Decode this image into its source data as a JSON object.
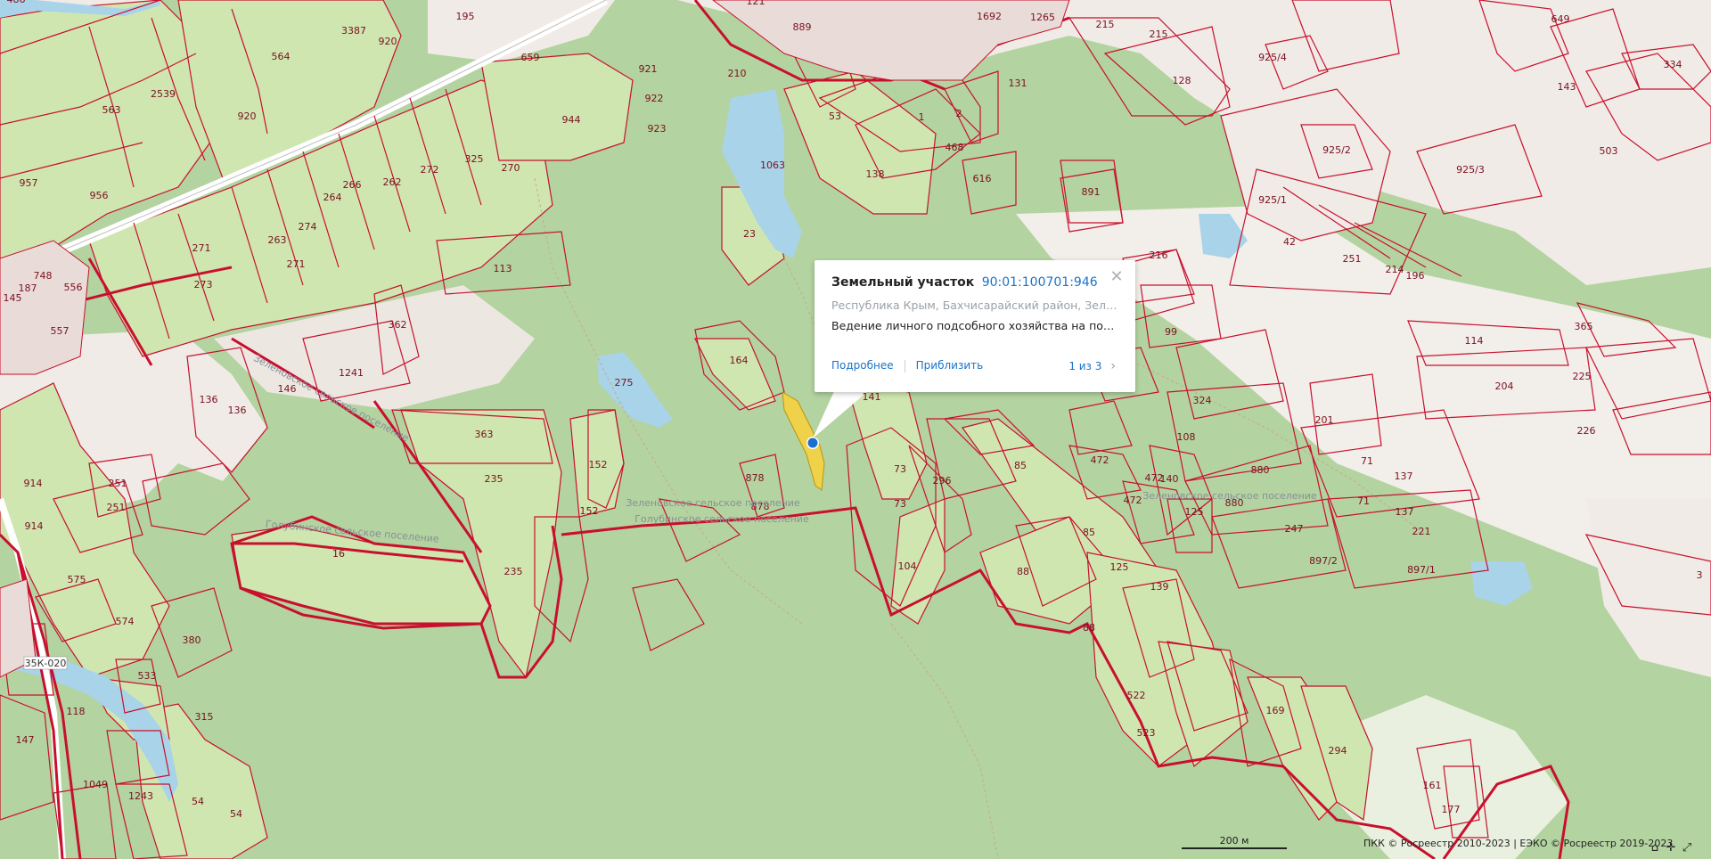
{
  "popup": {
    "title": "Земельный участок",
    "cadastral_number": "90:01:100701:946",
    "address": "Республика Крым, Бахчисарайский район, Зеленовс...",
    "land_use": "Ведение личного подсобного хозяйства на полевых...",
    "more_label": "Подробнее",
    "zoom_label": "Приблизить",
    "pager": "1 из 3",
    "close_icon": "close-icon",
    "next_icon": "chevron-right-icon"
  },
  "map": {
    "colors": {
      "background": "#b3d3a0",
      "forest": "#a8cb92",
      "light_green": "#cfe6b0",
      "land": "#f0ebe6",
      "water": "#a8d3e8",
      "border": "#c8102e",
      "selected": "#f0d24a",
      "marker": "#1a6fd1"
    },
    "labels": {
      "plots": [
        "486",
        "195",
        "3387",
        "920",
        "564",
        "2539",
        "920",
        "563",
        "957",
        "956",
        "659",
        "921",
        "922",
        "923",
        "944",
        "210",
        "53",
        "138",
        "1063",
        "23",
        "121",
        "889",
        "1265",
        "1692",
        "215",
        "215",
        "128",
        "649",
        "143",
        "503",
        "334",
        "925/4",
        "925/2",
        "925/3",
        "925/1",
        "891",
        "216",
        "42",
        "251",
        "214",
        "196",
        "114",
        "365",
        "204",
        "225",
        "226",
        "113",
        "271",
        "271",
        "273",
        "263",
        "274",
        "264",
        "266",
        "262",
        "272",
        "325",
        "270",
        "362",
        "1241",
        "146",
        "136",
        "136",
        "557",
        "556",
        "748",
        "187",
        "145",
        "914",
        "914",
        "251",
        "251",
        "575",
        "574",
        "380",
        "533",
        "118",
        "147",
        "1049",
        "1243",
        "54",
        "54",
        "315",
        "363",
        "235",
        "235",
        "16",
        "275",
        "152",
        "152",
        "164",
        "878",
        "878",
        "141",
        "73",
        "73",
        "104",
        "296",
        "85",
        "85",
        "472",
        "472",
        "472",
        "140",
        "125",
        "125",
        "139",
        "88",
        "88",
        "522",
        "523",
        "169",
        "294",
        "161",
        "177",
        "3",
        "99",
        "324",
        "108",
        "880",
        "880",
        "247",
        "897/2",
        "201",
        "71",
        "71",
        "137",
        "137",
        "221",
        "897/1",
        "468",
        "616",
        "1",
        "2",
        "131"
      ],
      "areas": [
        "Зеленовское сельское поселение",
        "Голубинское сельское поселение",
        "Зеленовское сельское поселение",
        "Голубинское сельское поселение",
        "Зеленовское сельское поселение"
      ],
      "roads": [
        "35К-020"
      ]
    }
  },
  "scale": {
    "label": "200 м"
  },
  "attribution": "ПКК © Росреестр 2010-2023 | ЕЭКО © Росреестр 2019-2023",
  "tools": {
    "home_icon": "home-icon",
    "locate_icon": "locate-icon",
    "fullscreen_icon": "fullscreen-icon"
  }
}
